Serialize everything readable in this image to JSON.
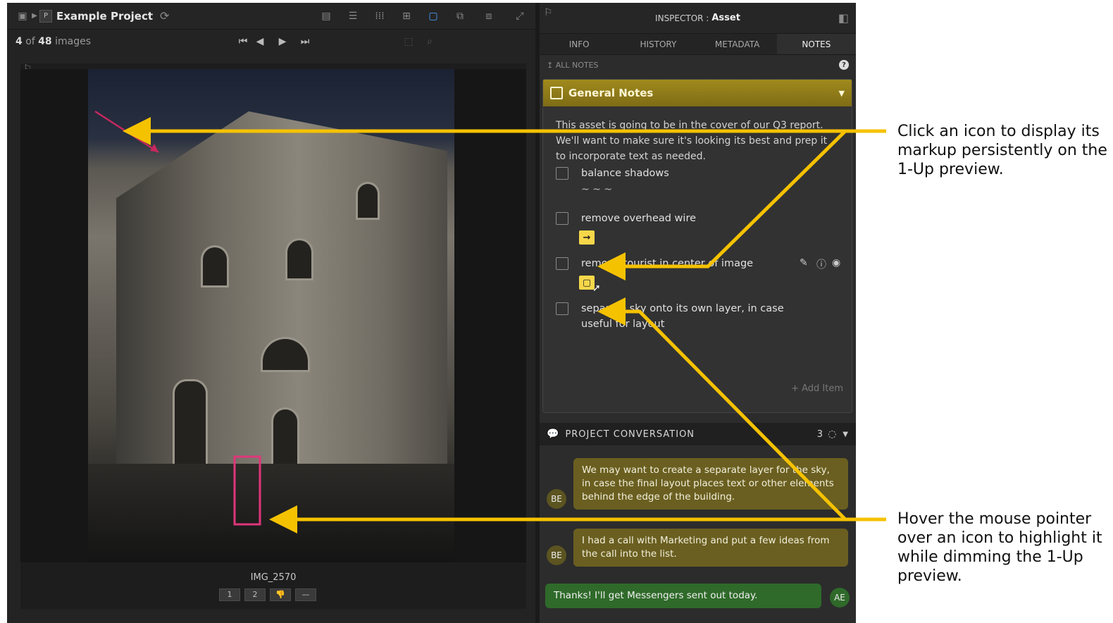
{
  "window": {
    "project_title": "Example Project",
    "count_current": "4",
    "count_of": "of",
    "count_total": "48",
    "count_unit": "images"
  },
  "viewer": {
    "filename": "IMG_2570",
    "rating_buttons": [
      "1",
      "2",
      "",
      "—"
    ]
  },
  "inspector": {
    "heading_prefix": "INSPECTOR :",
    "heading_name": "Asset",
    "tabs": [
      "INFO",
      "HISTORY",
      "METADATA",
      "NOTES"
    ],
    "active_tab": "NOTES",
    "all_notes_label": "ALL NOTES",
    "notes_title": "General Notes",
    "notes_text": "This asset is going to be in the cover of our Q3 report. We'll want to make sure it's looking its best and prep it to incorporate text as needed.",
    "checklist": [
      {
        "label": "balance shadows",
        "markup": "~ ~ ~"
      },
      {
        "label": "remove overhead wire",
        "markup": "→"
      },
      {
        "label": "remove tourist in center of image",
        "markup": "▢"
      },
      {
        "label": "separate sky onto its own layer, in case useful for layout",
        "markup": ""
      }
    ],
    "add_item": "+ Add Item"
  },
  "conversation": {
    "title": "PROJECT CONVERSATION",
    "count": "3",
    "messages": [
      {
        "author": "BE",
        "text": "We may want to create a separate layer for the sky, in case the final layout places text or other elements behind the edge of the building."
      },
      {
        "author": "BE",
        "text": "I had a call with Marketing and put a few ideas from the call into the list."
      },
      {
        "author": "AE",
        "text": "Thanks! I'll get Messengers sent out today."
      }
    ]
  },
  "annotations": {
    "top": "Click an icon to display its markup persistently on the 1-Up preview.",
    "bottom": "Hover the mouse pointer over an icon to highlight it while dimming the 1-Up preview."
  },
  "colors": {
    "callout_arrow": "#f5c200",
    "notes_header": "#8c7a1a",
    "highlight_box": "#e0357a"
  }
}
